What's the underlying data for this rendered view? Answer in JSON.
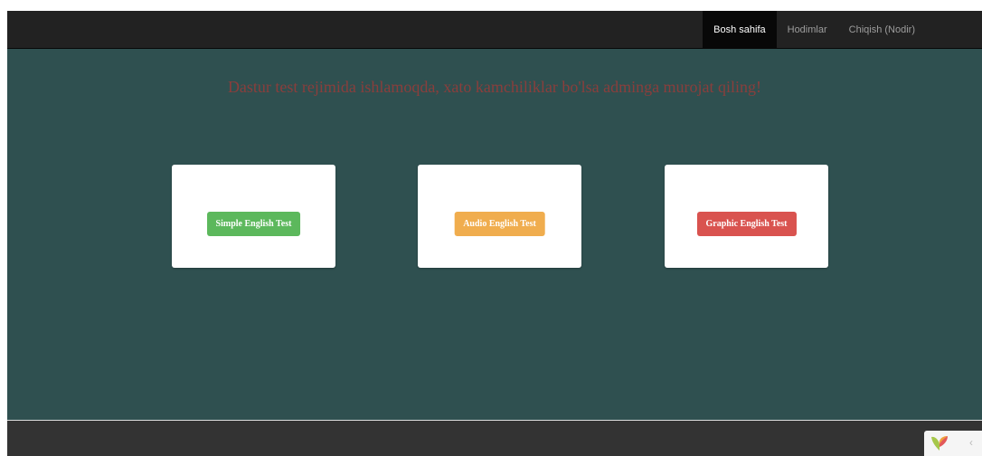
{
  "nav": {
    "items": [
      {
        "label": "Bosh sahifa",
        "active": true
      },
      {
        "label": "Hodimlar",
        "active": false
      },
      {
        "label": "Chiqish (Nodir)",
        "active": false
      }
    ]
  },
  "main": {
    "notice": "Dastur test rejimida ishlamoqda, xato kamchiliklar bo'lsa adminga murojat qiling!",
    "cards": [
      {
        "button_label": "Simple English Test",
        "color": "#5cb85c"
      },
      {
        "button_label": "Audio English Test",
        "color": "#f0ad4e"
      },
      {
        "button_label": "Graphic English Test",
        "color": "#d9534f"
      }
    ]
  },
  "debug_toolbar": {
    "toggle_glyph": "‹",
    "logo_icon": "yii-logo-icon"
  },
  "colors": {
    "navbar": "#222222",
    "main_background": "#2f5050",
    "notice_text": "#8a3e3c",
    "footer": "#333333"
  }
}
